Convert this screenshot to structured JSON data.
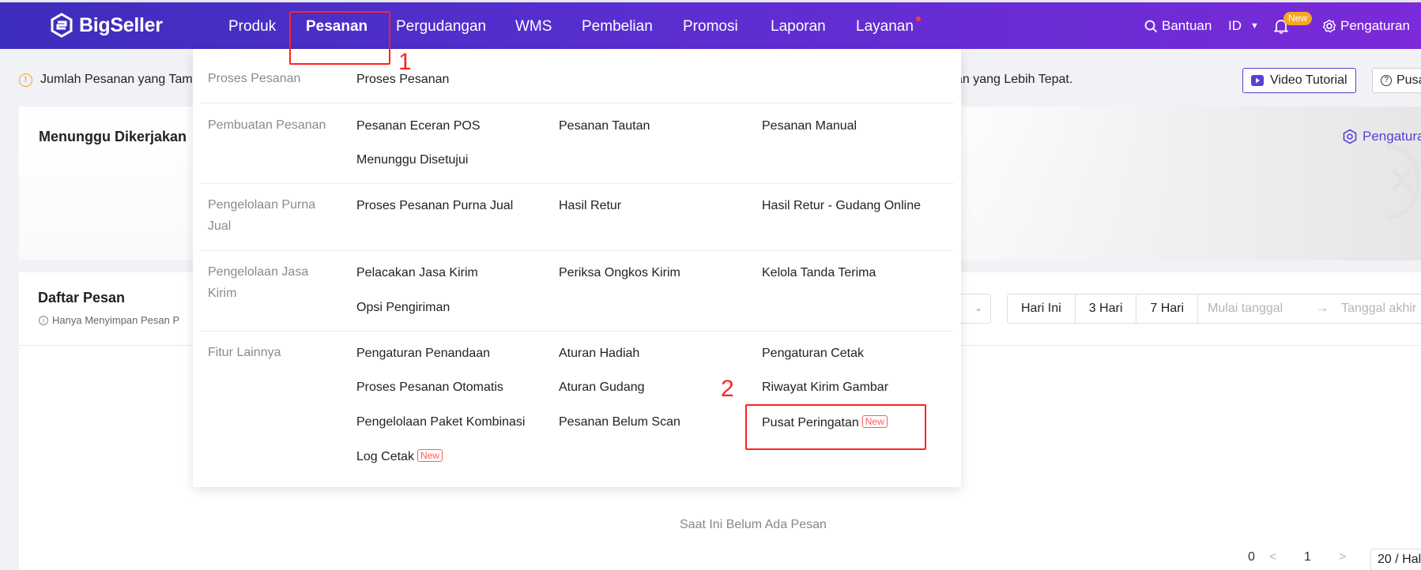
{
  "brand": {
    "name": "BigSeller"
  },
  "nav": {
    "items": [
      "Produk",
      "Pesanan",
      "Pergudangan",
      "WMS",
      "Pembelian",
      "Promosi",
      "Laporan",
      "Layanan"
    ],
    "active": "Pesanan",
    "help": "Bantuan",
    "lang": "ID",
    "new_badge": "New",
    "settings": "Pengaturan"
  },
  "notice": {
    "left_text": "Jumlah Pesanan yang Tam",
    "right_text": "an yang Lebih Tepat.",
    "video_button": "Video Tutorial",
    "pusat_button": "Pusa"
  },
  "card1": {
    "title": "Menunggu Dikerjakan",
    "settings_link": "Pengatura"
  },
  "card2": {
    "title": "Daftar Pesan",
    "subtitle": "Hanya Menyimpan Pesan P",
    "date_buttons": [
      "Hari Ini",
      "3 Hari",
      "7 Hari"
    ],
    "start_placeholder": "Mulai tanggal",
    "arrow": "→",
    "end_placeholder": "Tanggal akhir",
    "empty_text": "Saat Ini Belum Ada Pesan",
    "pager": {
      "total": "0",
      "prev": "<",
      "page": "1",
      "next": ">",
      "size": "20 / Hala"
    }
  },
  "menu": {
    "sections": [
      {
        "category": "Proses Pesanan",
        "links": [
          "Proses Pesanan"
        ]
      },
      {
        "category": "Pembuatan Pesanan",
        "links": [
          "Pesanan Eceran POS",
          "Pesanan Tautan",
          "Pesanan Manual",
          "Menunggu Disetujui"
        ]
      },
      {
        "category": "Pengelolaan Purna Jual",
        "links": [
          "Proses Pesanan Purna Jual",
          "Hasil Retur",
          "Hasil Retur - Gudang Online"
        ]
      },
      {
        "category": "Pengelolaan Jasa Kirim",
        "links": [
          "Pelacakan Jasa Kirim",
          "Periksa Ongkos Kirim",
          "Kelola Tanda Terima",
          "Opsi Pengiriman"
        ]
      },
      {
        "category": "Fitur Lainnya",
        "links": [
          "Pengaturan Penandaan",
          "Aturan Hadiah",
          "Pengaturan Cetak",
          "Proses Pesanan Otomatis",
          "Aturan Gudang",
          "Riwayat Kirim Gambar",
          "Pengelolaan Paket Kombinasi",
          "Pesanan Belum Scan",
          "Pusat Peringatan",
          "Log Cetak"
        ]
      }
    ],
    "new_tag": "New"
  },
  "annotations": {
    "num1": "1",
    "num2": "2"
  },
  "colors": {
    "accent": "#5b3ed6",
    "annotation": "#ff2222",
    "nav_start": "#3d2dbd",
    "nav_end": "#7a2ad8"
  }
}
